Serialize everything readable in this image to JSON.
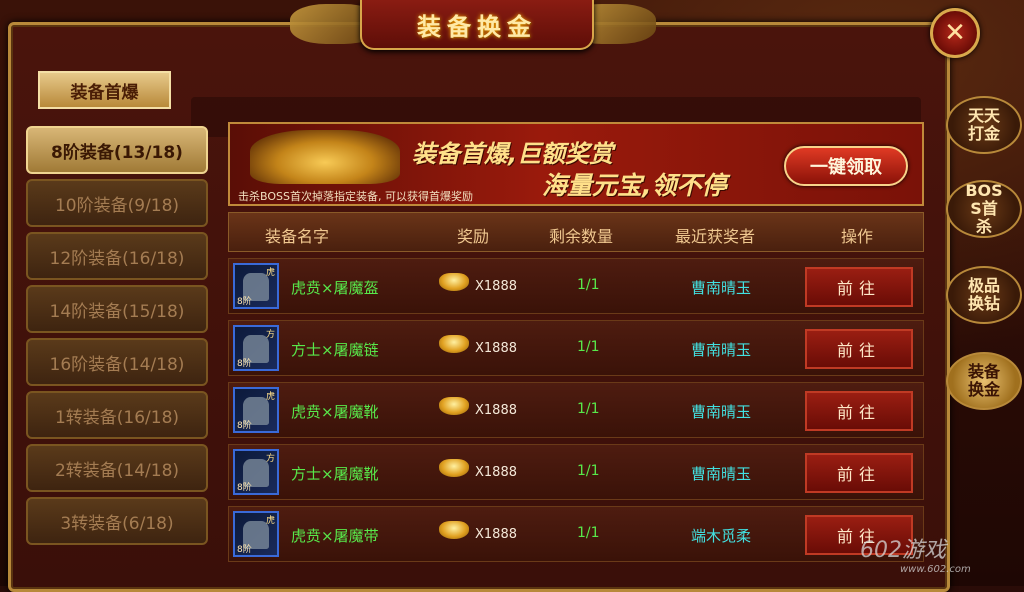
{
  "window": {
    "title": "装备换金",
    "close_glyph": "✕"
  },
  "top_tab": {
    "label": "装备首爆"
  },
  "levels": [
    {
      "label": "8阶装备(13/18)",
      "active": true
    },
    {
      "label": "10阶装备(9/18)",
      "active": false
    },
    {
      "label": "12阶装备(16/18)",
      "active": false
    },
    {
      "label": "14阶装备(15/18)",
      "active": false
    },
    {
      "label": "16阶装备(14/18)",
      "active": false
    },
    {
      "label": "1转装备(16/18)",
      "active": false
    },
    {
      "label": "2转装备(14/18)",
      "active": false
    },
    {
      "label": "3转装备(6/18)",
      "active": false
    }
  ],
  "banner": {
    "line1": "装备首爆,巨额奖赏",
    "line2": "海量元宝,领不停",
    "note": "击杀BOSS首次掉落指定装备, 可以获得首爆奖励",
    "claim_label": "一键领取"
  },
  "table": {
    "headers": [
      "装备名字",
      "奖励",
      "剩余数量",
      "最近获奖者",
      "操作"
    ],
    "rows": [
      {
        "tag": "虎",
        "level": "8阶",
        "name": "虎贲×屠魔盔",
        "reward": "X1888",
        "remain": "1/1",
        "winner": "曹南晴玉",
        "action": "前往"
      },
      {
        "tag": "方",
        "level": "8阶",
        "name": "方士×屠魔链",
        "reward": "X1888",
        "remain": "1/1",
        "winner": "曹南晴玉",
        "action": "前往"
      },
      {
        "tag": "虎",
        "level": "8阶",
        "name": "虎贲×屠魔靴",
        "reward": "X1888",
        "remain": "1/1",
        "winner": "曹南晴玉",
        "action": "前往"
      },
      {
        "tag": "方",
        "level": "8阶",
        "name": "方士×屠魔靴",
        "reward": "X1888",
        "remain": "1/1",
        "winner": "曹南晴玉",
        "action": "前往"
      },
      {
        "tag": "虎",
        "level": "8阶",
        "name": "虎贲×屠魔带",
        "reward": "X1888",
        "remain": "1/1",
        "winner": "端木觅柔",
        "action": "前往"
      }
    ]
  },
  "side_nav": [
    {
      "label": "天天打金",
      "active": false
    },
    {
      "label": "BOSS首杀",
      "active": false
    },
    {
      "label": "极品换钻",
      "active": false
    },
    {
      "label": "装备换金",
      "active": true
    }
  ],
  "watermark": {
    "brand": "602游戏",
    "url": "www.602.com"
  },
  "icons": {
    "reward": "gold-ingot-icon"
  },
  "colors": {
    "name_green": "#58e84a",
    "winner_cyan": "#42e0e0",
    "gold": "#ffe08a"
  }
}
